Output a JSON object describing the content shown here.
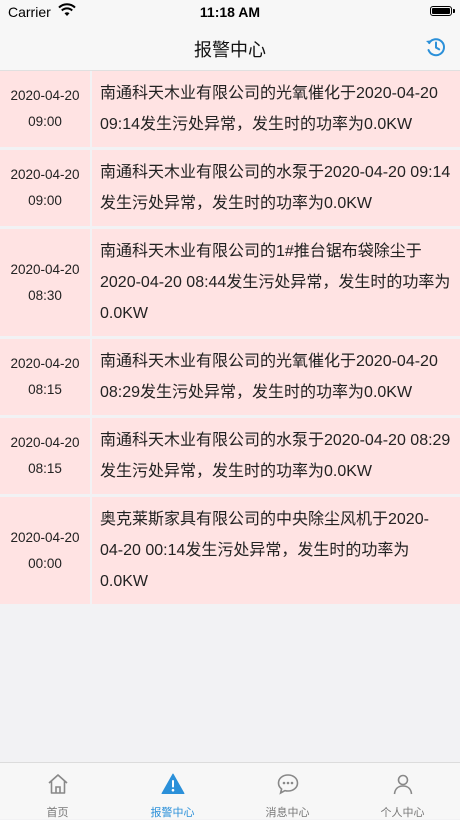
{
  "status": {
    "carrier": "Carrier",
    "time": "11:18 AM"
  },
  "nav": {
    "title": "报警中心",
    "history_icon": "history-icon"
  },
  "alarms": [
    {
      "date": "2020-04-20",
      "time": "09:00",
      "message": "南通科天木业有限公司的光氧催化于2020-04-20 09:14发生污处异常，发生时的功率为0.0KW"
    },
    {
      "date": "2020-04-20",
      "time": "09:00",
      "message": "南通科天木业有限公司的水泵于2020-04-20 09:14发生污处异常，发生时的功率为0.0KW"
    },
    {
      "date": "2020-04-20",
      "time": "08:30",
      "message": "南通科天木业有限公司的1#推台锯布袋除尘于2020-04-20 08:44发生污处异常，发生时的功率为0.0KW"
    },
    {
      "date": "2020-04-20",
      "time": "08:15",
      "message": "南通科天木业有限公司的光氧催化于2020-04-20 08:29发生污处异常，发生时的功率为0.0KW"
    },
    {
      "date": "2020-04-20",
      "time": "08:15",
      "message": "南通科天木业有限公司的水泵于2020-04-20 08:29发生污处异常，发生时的功率为0.0KW"
    },
    {
      "date": "2020-04-20",
      "time": "00:00",
      "message": "奥克莱斯家具有限公司的中央除尘风机于2020-04-20 00:14发生污处异常，发生时的功率为0.0KW"
    }
  ],
  "tabs": [
    {
      "label": "首页",
      "icon": "home-icon",
      "active": false
    },
    {
      "label": "报警中心",
      "icon": "alert-icon",
      "active": true
    },
    {
      "label": "消息中心",
      "icon": "chat-icon",
      "active": false
    },
    {
      "label": "个人中心",
      "icon": "person-icon",
      "active": false
    }
  ],
  "colors": {
    "accent": "#2b90d9",
    "row_bg": "#ffe3e3",
    "page_bg": "#f2f2f4"
  }
}
